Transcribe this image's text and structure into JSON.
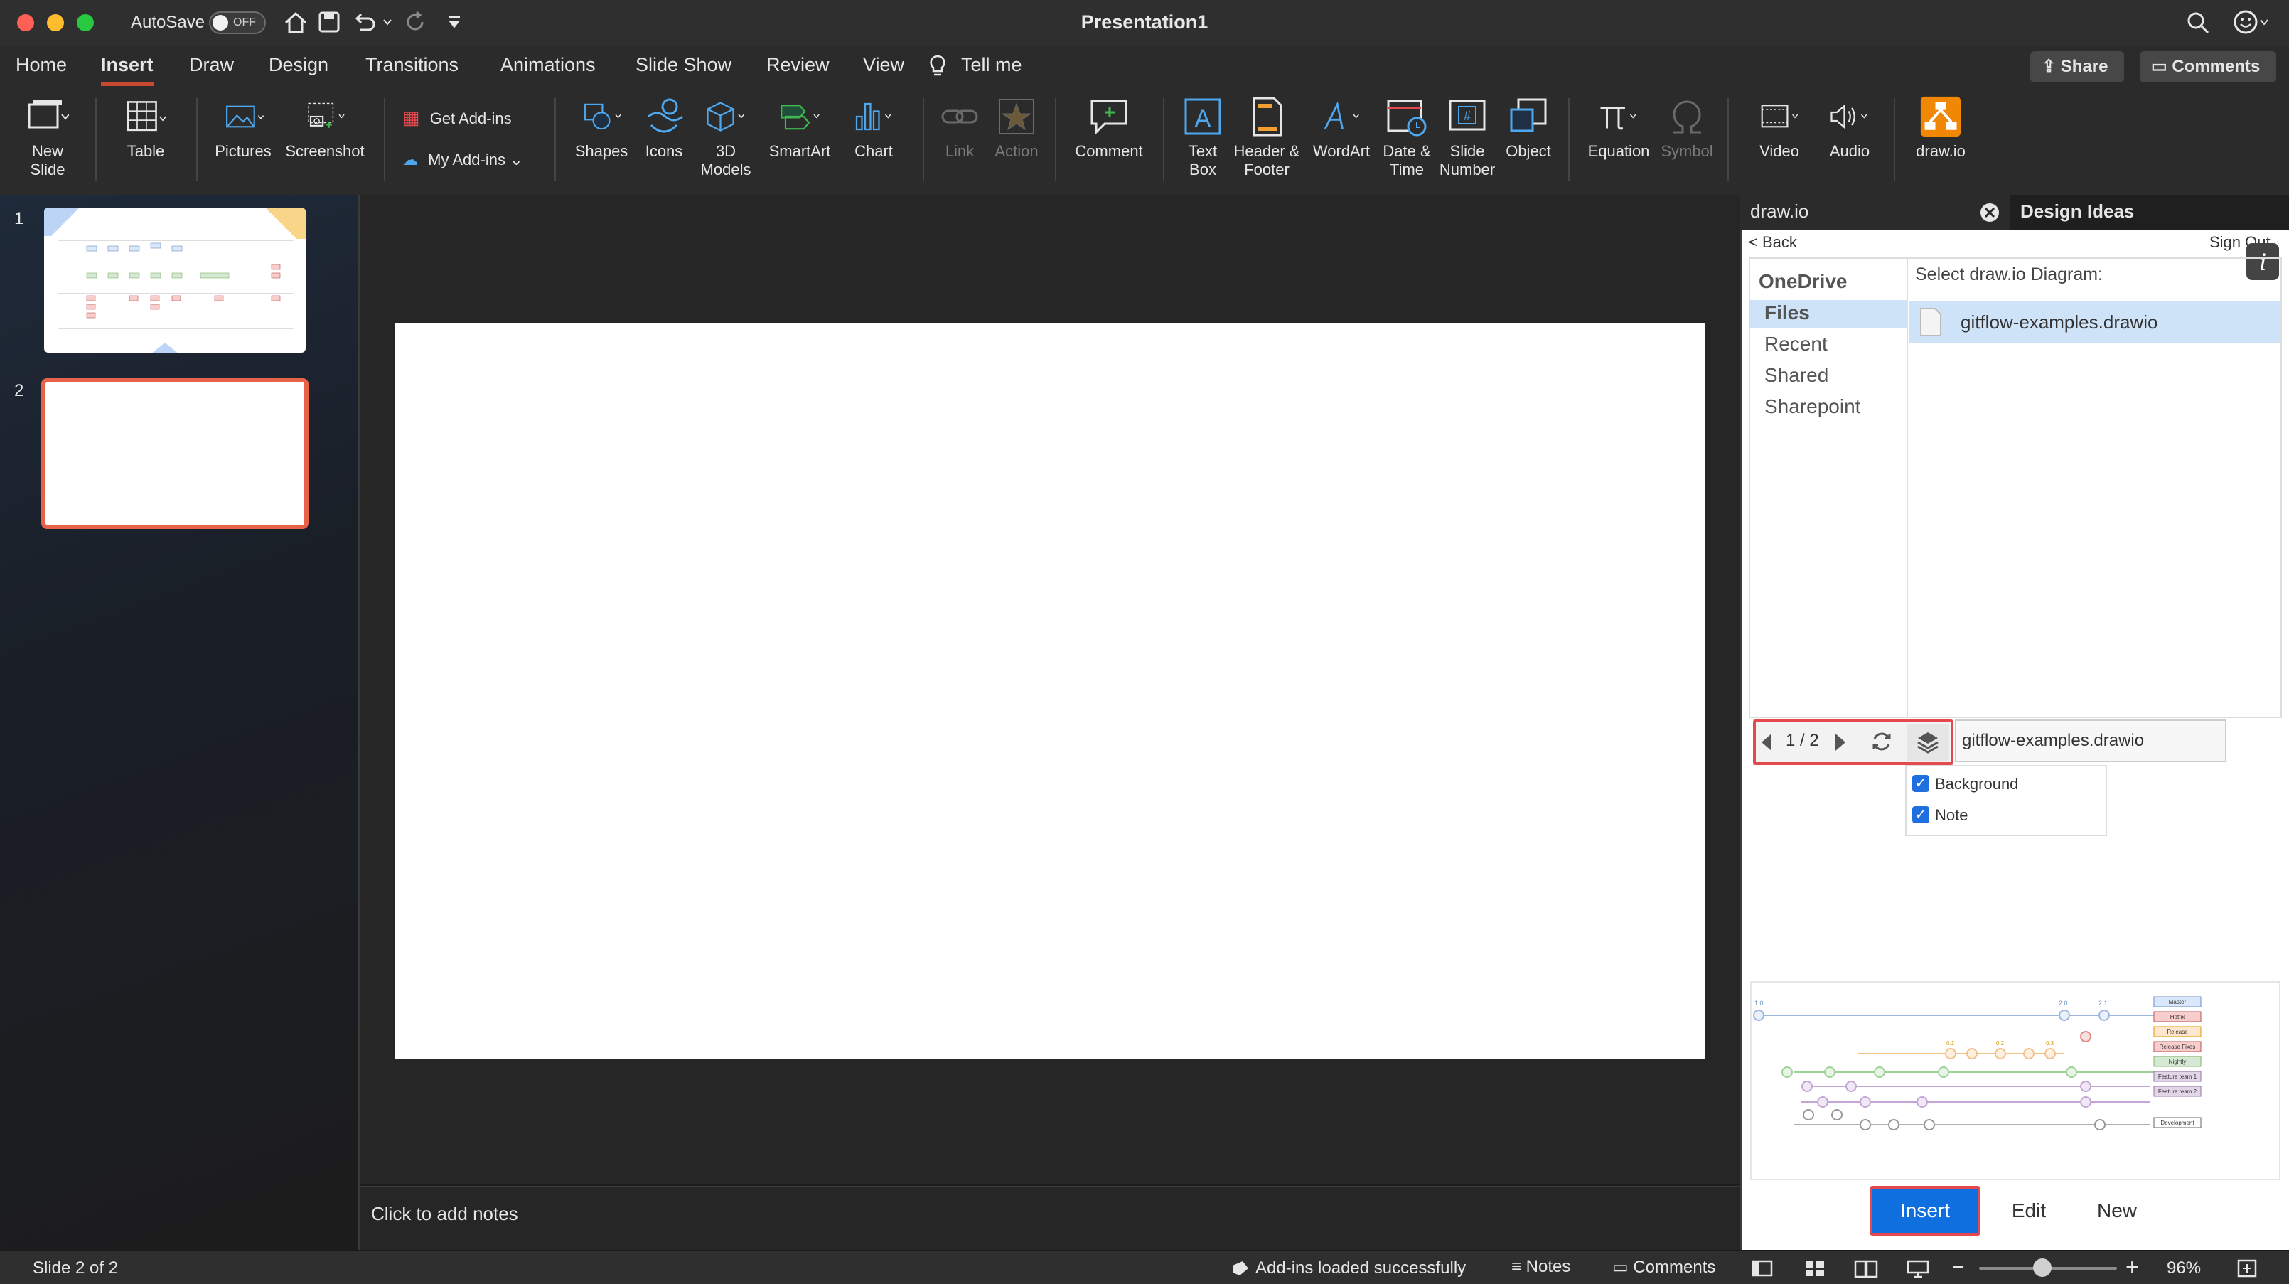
{
  "window": {
    "title": "Presentation1",
    "autosave_label": "AutoSave",
    "autosave_state": "OFF"
  },
  "tabs": [
    "Home",
    "Insert",
    "Draw",
    "Design",
    "Transitions",
    "Animations",
    "Slide Show",
    "Review",
    "View"
  ],
  "tell_me": "Tell me",
  "share_label": "Share",
  "comments_label": "Comments",
  "ribbon": {
    "new_slide": [
      "New",
      "Slide"
    ],
    "table": "Table",
    "pictures": "Pictures",
    "screenshot": "Screenshot",
    "get_addins": "Get Add-ins",
    "my_addins": "My Add-ins",
    "shapes": "Shapes",
    "icons": "Icons",
    "models": [
      "3D",
      "Models"
    ],
    "smartart": "SmartArt",
    "chart": "Chart",
    "link": "Link",
    "action": "Action",
    "comment": "Comment",
    "textbox": [
      "Text",
      "Box"
    ],
    "header_footer": [
      "Header &",
      "Footer"
    ],
    "wordart": "WordArt",
    "date_time": [
      "Date &",
      "Time"
    ],
    "slide_number": [
      "Slide",
      "Number"
    ],
    "object": "Object",
    "equation": "Equation",
    "symbol": "Symbol",
    "video": "Video",
    "audio": "Audio",
    "drawio": "draw.io"
  },
  "slides": [
    "1",
    "2"
  ],
  "notes_placeholder": "Click to add notes",
  "pane": {
    "tab_drawio": "draw.io",
    "tab_design_ideas": "Design Ideas",
    "back": "< Back",
    "sign_out": "Sign Out",
    "sources": [
      "OneDrive",
      "Files",
      "Recent",
      "Shared",
      "Sharepoint"
    ],
    "select_label": "Select draw.io Diagram:",
    "file": "gitflow-examples.drawio",
    "page_indicator": "1 / 2",
    "filename_field": "gitflow-examples.drawio",
    "layers": [
      "Background",
      "Note"
    ],
    "buttons": {
      "insert": "Insert",
      "edit": "Edit",
      "new": "New"
    },
    "preview": {
      "top_labels": [
        "1.0",
        "2.0",
        "2.1"
      ],
      "mid_labels": [
        "0.1",
        "0.2",
        "0.3"
      ],
      "legend": [
        {
          "label": "Master",
          "color": "#dae8fc",
          "border": "#6c8ebf"
        },
        {
          "label": "Hotfix",
          "color": "#f8cecc",
          "border": "#b85450"
        },
        {
          "label": "Release",
          "color": "#ffe6cc",
          "border": "#d79b00"
        },
        {
          "label": "Release Fixes",
          "color": "#f8cecc",
          "border": "#b85450"
        },
        {
          "label": "Nightly",
          "color": "#d5e8d4",
          "border": "#82b366"
        },
        {
          "label": "Feature team 1",
          "color": "#e1d5e7",
          "border": "#9673a6"
        },
        {
          "label": "Feature team 2",
          "color": "#e1d5e7",
          "border": "#9673a6"
        },
        {
          "label": "Development",
          "color": "#ffffff",
          "border": "#666666"
        }
      ]
    }
  },
  "status": {
    "slide_info": "Slide 2 of 2",
    "addins": "Add-ins loaded successfully",
    "notes": "Notes",
    "comments": "Comments",
    "zoom": "96%"
  },
  "colors": {
    "accent": "#c84b31",
    "insert_button": "#0f6fde",
    "highlight": "#e5484d",
    "selection": "#cfe3f8",
    "drawio_orange": "#f08705"
  }
}
